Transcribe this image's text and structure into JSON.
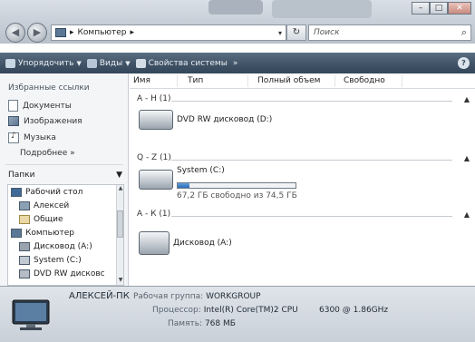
{
  "window": {
    "buttons": {
      "minimize": "–",
      "maximize": "□",
      "close": "✕"
    }
  },
  "address_bar": {
    "path": "Компьютер",
    "separator": "▸",
    "dropdown_glyph": "▾",
    "refresh_glyph": "↻"
  },
  "search": {
    "placeholder": "Поиск",
    "icon": "search-icon"
  },
  "toolbar": {
    "organize": "Упорядочить",
    "views": "Виды",
    "system_properties": "Свойства системы",
    "more": "»",
    "help": "?"
  },
  "nav": {
    "favorites_title": "Избранные ссылки",
    "links": [
      {
        "label": "Документы",
        "icon": "document-icon"
      },
      {
        "label": "Изображения",
        "icon": "pictures-icon"
      },
      {
        "label": "Музыка",
        "icon": "music-icon"
      }
    ],
    "more": "Подробнее »",
    "folders": "Папки",
    "tree": [
      {
        "label": "Рабочий стол",
        "icon": "desktop-icon"
      },
      {
        "label": "Алексей",
        "icon": "user-folder-icon"
      },
      {
        "label": "Общие",
        "icon": "public-folder-icon"
      },
      {
        "label": "Компьютер",
        "icon": "computer-icon"
      },
      {
        "label": "Дисковод (A:)",
        "icon": "floppy-icon"
      },
      {
        "label": "System (C:)",
        "icon": "hard-drive-icon"
      },
      {
        "label": "DVD RW дисковс",
        "icon": "dvd-icon"
      }
    ]
  },
  "columns": [
    "Имя",
    "Тип",
    "Полный объем",
    "Свободно"
  ],
  "groups": [
    {
      "label": "А - Н (1)",
      "items": [
        {
          "name": "DVD RW дисковод (D:)",
          "icon": "dvd-drive-icon"
        }
      ]
    },
    {
      "label": "Q - Z (1)",
      "items": [
        {
          "name": "System (C:)",
          "icon": "hard-drive-icon",
          "free_text": "67,2 ГБ свободно из 74,5 ГБ",
          "used_fraction": 0.098
        }
      ]
    },
    {
      "label": "А - К (1)",
      "items": [
        {
          "name": "Дисковод (A:)",
          "icon": "floppy-drive-icon"
        }
      ]
    }
  ],
  "details": {
    "computer_name": "АЛЕКСЕЙ-ПК",
    "workgroup_label": "Рабочая группа:",
    "workgroup": "WORKGROUP",
    "processor_label": "Процессор:",
    "processor": "Intel(R) Core(TM)2 CPU",
    "processor_speed": "6300 @ 1.86GHz",
    "memory_label": "Память:",
    "memory": "768 МБ"
  },
  "colors": {
    "toolbar_bg": "#3f5164",
    "capacity_fill": "#2a6ab8",
    "details_bg": "#c9d0d8"
  }
}
